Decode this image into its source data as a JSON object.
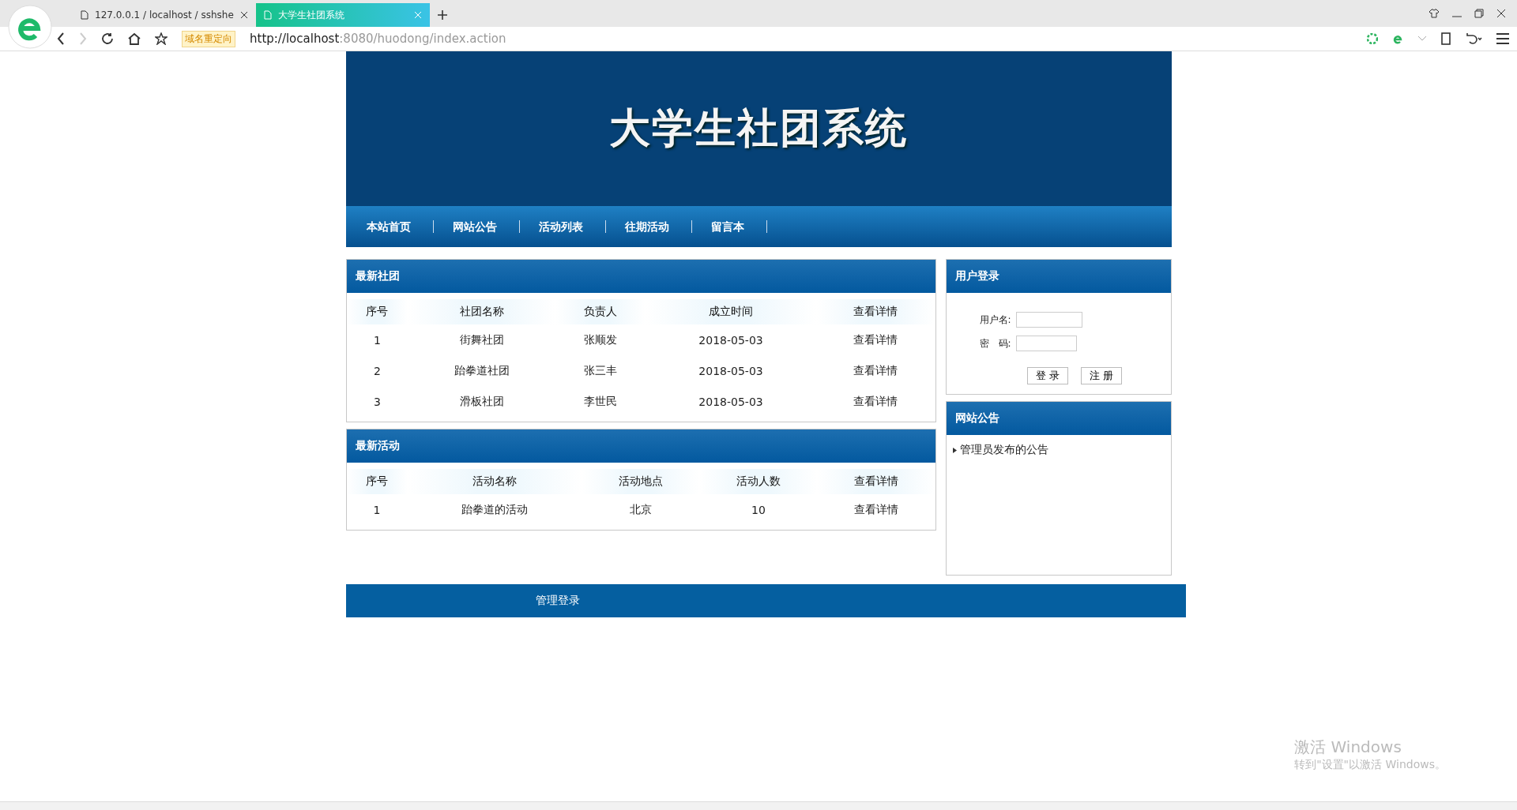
{
  "browser": {
    "tabs": [
      {
        "title": "127.0.0.1 / localhost / sshshe",
        "selected": false
      },
      {
        "title": "大学生社团系统",
        "selected": true
      }
    ],
    "redirect_badge": "域名重定向",
    "url_host": "http://localhost",
    "url_rest": ":8080/huodong/index.action"
  },
  "banner": {
    "title": "大学生社团系统"
  },
  "nav": [
    "本站首页",
    "网站公告",
    "活动列表",
    "往期活动",
    "留言本"
  ],
  "clubs": {
    "title": "最新社团",
    "columns": [
      "序号",
      "社团名称",
      "负责人",
      "成立时间",
      "查看详情"
    ],
    "rows": [
      [
        "1",
        "街舞社团",
        "张顺发",
        "2018-05-03",
        "查看详情"
      ],
      [
        "2",
        "跆拳道社团",
        "张三丰",
        "2018-05-03",
        "查看详情"
      ],
      [
        "3",
        "滑板社团",
        "李世民",
        "2018-05-03",
        "查看详情"
      ]
    ]
  },
  "activities": {
    "title": "最新活动",
    "columns": [
      "序号",
      "活动名称",
      "活动地点",
      "活动人数",
      "查看详情"
    ],
    "rows": [
      [
        "1",
        "跆拳道的活动",
        "北京",
        "10",
        "查看详情"
      ]
    ]
  },
  "login": {
    "title": "用户登录",
    "username_label": "用户名:",
    "password_label": "密　码:",
    "buttons": [
      "登 录",
      "注 册"
    ]
  },
  "notices": {
    "title": "网站公告",
    "items": [
      "管理员发布的公告"
    ]
  },
  "footer": {
    "link": "管理登录"
  },
  "activation": {
    "title": "激活 Windows",
    "hint": "转到\"设置\"以激活 Windows。"
  }
}
